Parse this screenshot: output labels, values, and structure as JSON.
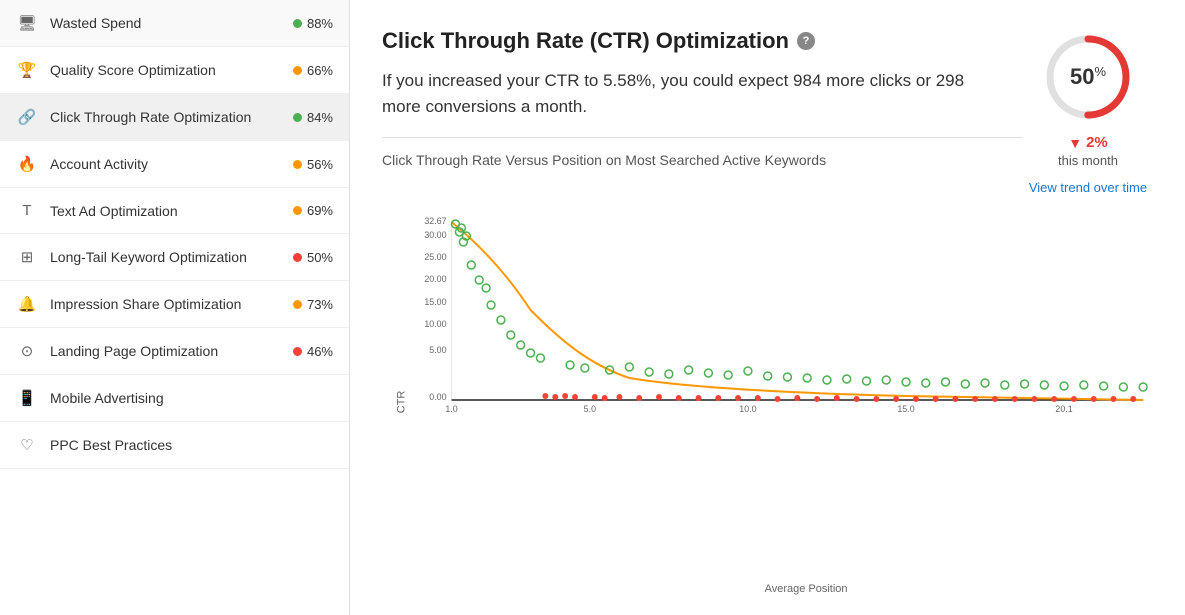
{
  "sidebar": {
    "items": [
      {
        "id": "wasted-spend",
        "icon": "🖥",
        "label": "Wasted Spend",
        "score": "88%",
        "dotClass": "dot-green",
        "active": false
      },
      {
        "id": "quality-score",
        "icon": "🏆",
        "label": "Quality Score Optimization",
        "score": "66%",
        "dotClass": "dot-orange",
        "active": false
      },
      {
        "id": "ctr",
        "icon": "🔗",
        "label": "Click Through Rate Optimization",
        "score": "84%",
        "dotClass": "dot-green",
        "active": true
      },
      {
        "id": "account-activity",
        "icon": "🔥",
        "label": "Account Activity",
        "score": "56%",
        "dotClass": "dot-orange",
        "active": false
      },
      {
        "id": "text-ad",
        "icon": "T",
        "label": "Text Ad Optimization",
        "score": "69%",
        "dotClass": "dot-orange",
        "active": false
      },
      {
        "id": "long-tail",
        "icon": "⊞",
        "label": "Long-Tail Keyword Optimization",
        "score": "50%",
        "dotClass": "dot-red",
        "active": false
      },
      {
        "id": "impression-share",
        "icon": "🔔",
        "label": "Impression Share Optimization",
        "score": "73%",
        "dotClass": "dot-orange",
        "active": false
      },
      {
        "id": "landing-page",
        "icon": "⊙",
        "label": "Landing Page Optimization",
        "score": "46%",
        "dotClass": "dot-red",
        "active": false
      },
      {
        "id": "mobile",
        "icon": "📱",
        "label": "Mobile Advertising",
        "score": "",
        "dotClass": "",
        "active": false
      },
      {
        "id": "ppc",
        "icon": "♡",
        "label": "PPC Best Practices",
        "score": "",
        "dotClass": "",
        "active": false
      }
    ]
  },
  "main": {
    "title": "Click Through Rate (CTR) Optimization",
    "description": "If you increased your CTR to 5.58%, you could expect 984 more clicks or 298 more conversions a month.",
    "chart_subtitle": "Click Through Rate Versus Position on Most Searched Active Keywords",
    "score": "50",
    "score_pct": "%",
    "change": "2%",
    "change_label": "this month",
    "view_trend": "View trend over time",
    "axis_y": "CTR",
    "axis_x": "Average Position",
    "y_labels": [
      "32.67",
      "30.00",
      "25.00",
      "20.00",
      "15.00",
      "10.00",
      "5.00",
      "0.00"
    ],
    "x_labels": [
      "1.0",
      "5.0",
      "10.0",
      "15.0",
      "20.1"
    ]
  }
}
